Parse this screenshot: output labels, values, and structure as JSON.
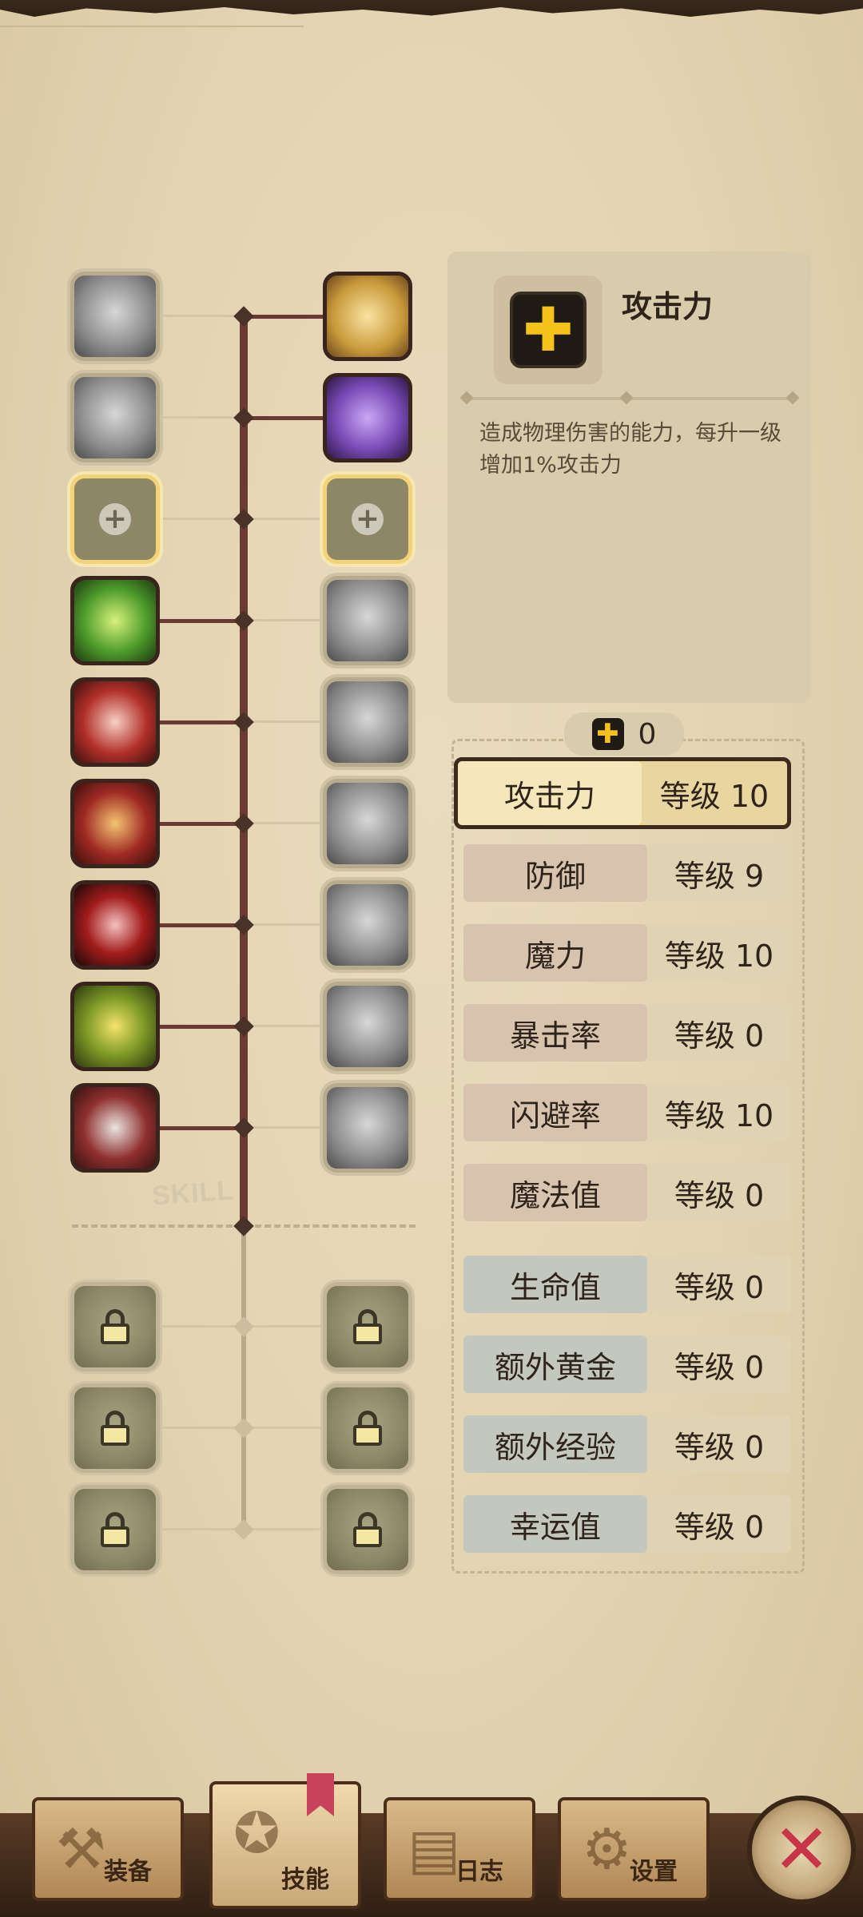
{
  "skills": {
    "left_column": [
      {
        "icon": "lightning-slash-icon",
        "state": "gray"
      },
      {
        "icon": "kick-figure-icon",
        "state": "gray"
      },
      {
        "icon": "empty-slot-plus-icon",
        "state": "slot"
      },
      {
        "icon": "flex-arm-icon",
        "state": "green"
      },
      {
        "icon": "rage-face-icon",
        "state": "red"
      },
      {
        "icon": "dagger-icon",
        "state": "red2"
      },
      {
        "icon": "ninja-icon",
        "state": "redblack"
      },
      {
        "icon": "lightning-warrior-icon",
        "state": "yellowgreen"
      },
      {
        "icon": "sword-icon",
        "state": "steel"
      }
    ],
    "right_column": [
      {
        "icon": "holy-shield-icon",
        "state": "gold"
      },
      {
        "icon": "dark-blade-icon",
        "state": "purple"
      },
      {
        "icon": "empty-slot-plus-icon",
        "state": "slot"
      },
      {
        "icon": "dash-figure-icon",
        "state": "gray"
      },
      {
        "icon": "smoke-figure-icon",
        "state": "gray"
      },
      {
        "icon": "eye-icon",
        "state": "gray"
      },
      {
        "icon": "boomerang-icon",
        "state": "gray"
      },
      {
        "icon": "cog-gear-icon",
        "state": "gray"
      },
      {
        "icon": "sparkle-figure-icon",
        "state": "gray"
      }
    ],
    "locked_rows": 3,
    "divider_text": "SKILL"
  },
  "info": {
    "title": "攻击力",
    "description": "造成物理伤害的能力，每升一级增加1%攻击力"
  },
  "points": {
    "value": "0"
  },
  "stats": {
    "attributes": [
      {
        "label": "攻击力",
        "level": "等级 10",
        "selected": true
      },
      {
        "label": "防御",
        "level": "等级 9"
      },
      {
        "label": "魔力",
        "level": "等级 10"
      },
      {
        "label": "暴击率",
        "level": "等级 0"
      },
      {
        "label": "闪避率",
        "level": "等级 10"
      },
      {
        "label": "魔法值",
        "level": "等级 0"
      }
    ],
    "misc": [
      {
        "label": "生命值",
        "level": "等级 0"
      },
      {
        "label": "额外黄金",
        "level": "等级 0"
      },
      {
        "label": "额外经验",
        "level": "等级 0"
      },
      {
        "label": "幸运值",
        "level": "等级 0"
      }
    ]
  },
  "nav": {
    "equipment": "装备",
    "skills": "技能",
    "log": "日志",
    "settings": "设置"
  },
  "colors": {
    "accent_gold": "#f4c21b",
    "close_red": "#c73548",
    "tree_rail": "#6b3b33"
  }
}
